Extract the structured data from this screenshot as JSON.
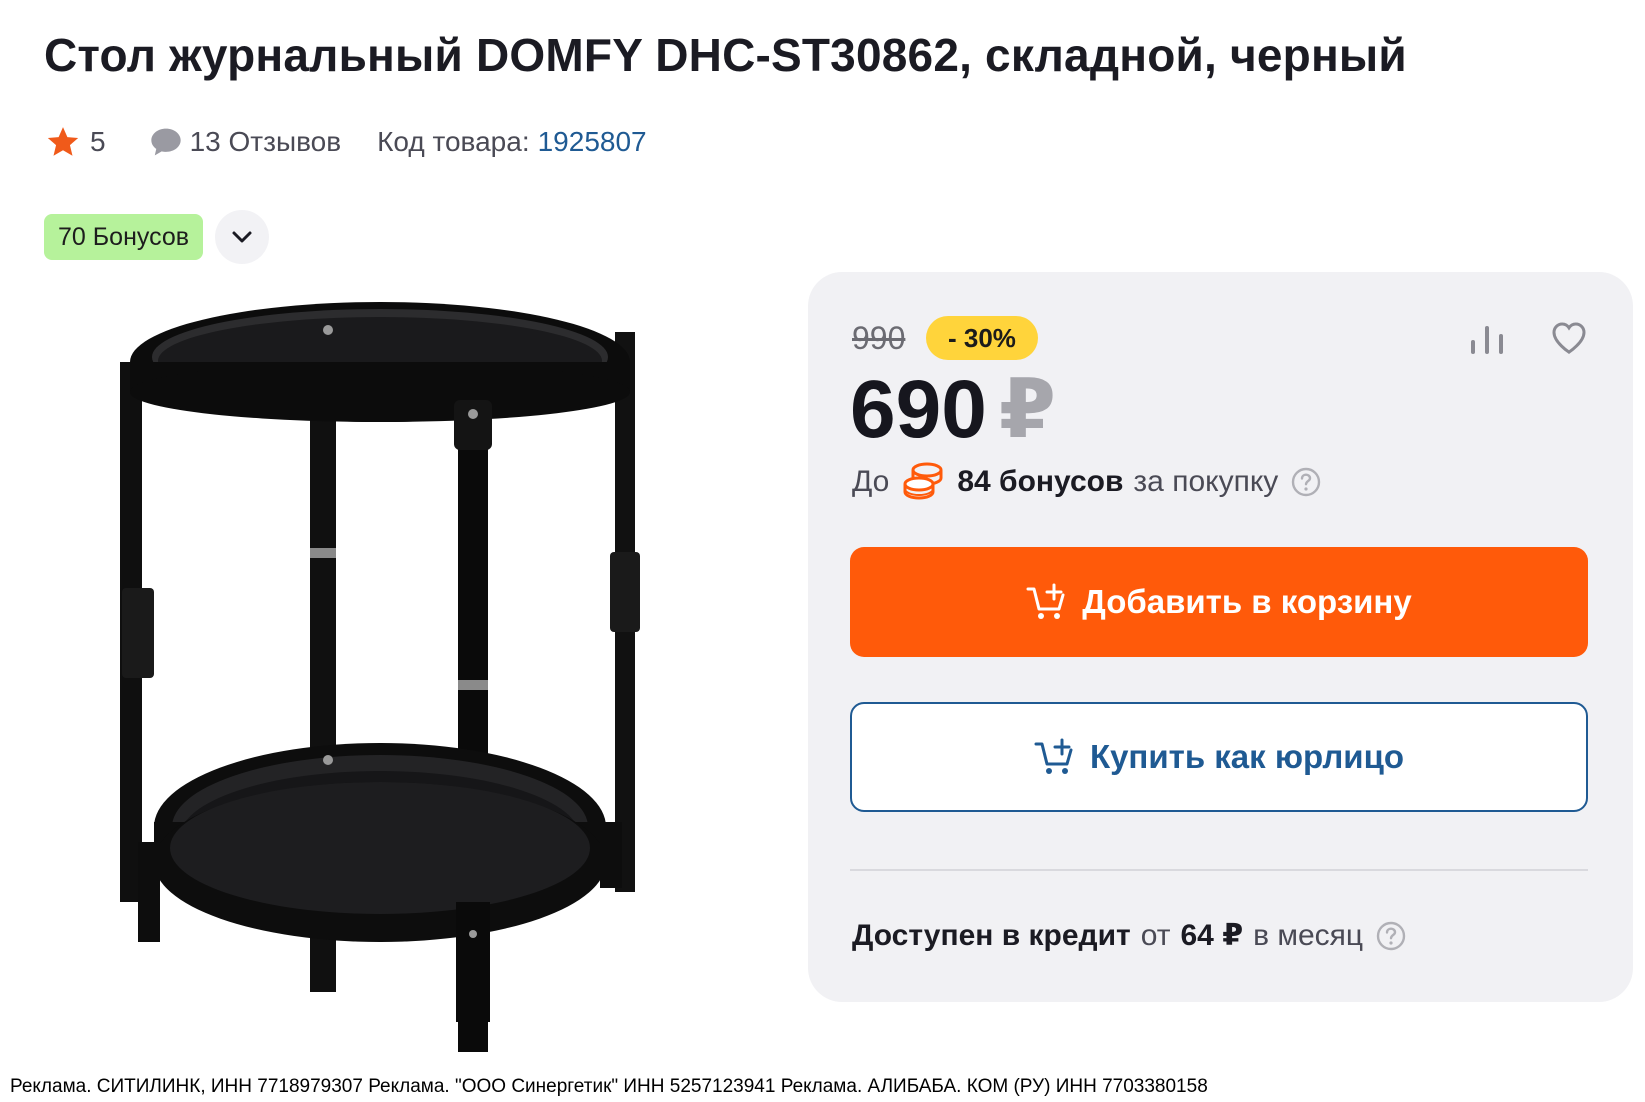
{
  "product": {
    "title": "Стол журнальный DOMFY DHC-ST30862, складной, черный",
    "rating": "5",
    "reviews": "13 Отзывов",
    "code_label": "Код товара:",
    "code_value": "1925807",
    "bonus_badge": "70 Бонусов",
    "image_alt": "Стол журнальный DOMFY DHC-ST30862"
  },
  "price_card": {
    "old_price": "990",
    "discount": "- 30%",
    "price": "690",
    "currency": "₽",
    "bonus_prefix": "До",
    "bonus_amount": "84 бонусов",
    "bonus_suffix": "за покупку",
    "add_to_cart": "Добавить в корзину",
    "buy_legal": "Купить как юрлицо",
    "credit_label": "Доступен в кредит",
    "credit_from": "от",
    "credit_amount": "64 ₽",
    "credit_period": "в месяц"
  },
  "footer": {
    "ads": "Реклама. СИТИЛИНК, ИНН 7718979307 Реклама. \"ООО Синергетик\" ИНН 5257123941 Реклама. АЛИБАБА. КОМ (РУ) ИНН 7703380158"
  },
  "colors": {
    "accent_orange": "#ff5a0a",
    "link_blue": "#1f5a93",
    "bonus_green": "#b6f29b",
    "discount_yellow": "#ffd43b",
    "star_orange": "#f05a1a"
  },
  "icons": [
    "star-icon",
    "chat-icon",
    "chevron-down-icon",
    "compare-icon",
    "heart-icon",
    "coins-icon",
    "help-icon",
    "cart-plus-icon"
  ]
}
